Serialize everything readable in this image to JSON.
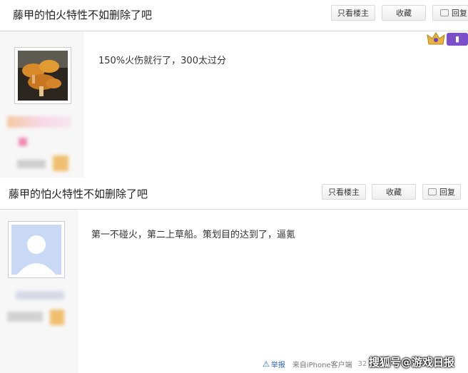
{
  "post1": {
    "title": "藤甲的怕火特性不如删除了吧",
    "buttons": {
      "only_op": "只看楼主",
      "favorite": "收藏",
      "reply": "回复"
    },
    "content": "150%火伤就行了，300太过分"
  },
  "post2": {
    "title": "藤甲的怕火特性不如删除了吧",
    "buttons": {
      "only_op": "只看楼主",
      "favorite": "收藏",
      "reply": "回复"
    },
    "content": "第一不碰火，第二上草船。策划目的达到了，逼氪"
  },
  "footer": {
    "report": "举报",
    "source": "来自iPhone客户端",
    "floor": "32",
    "watermark": "搜狐号@游戏日报"
  },
  "colors": {
    "accent_purple": "#7a4fc9",
    "report_blue": "#2d64b3"
  }
}
